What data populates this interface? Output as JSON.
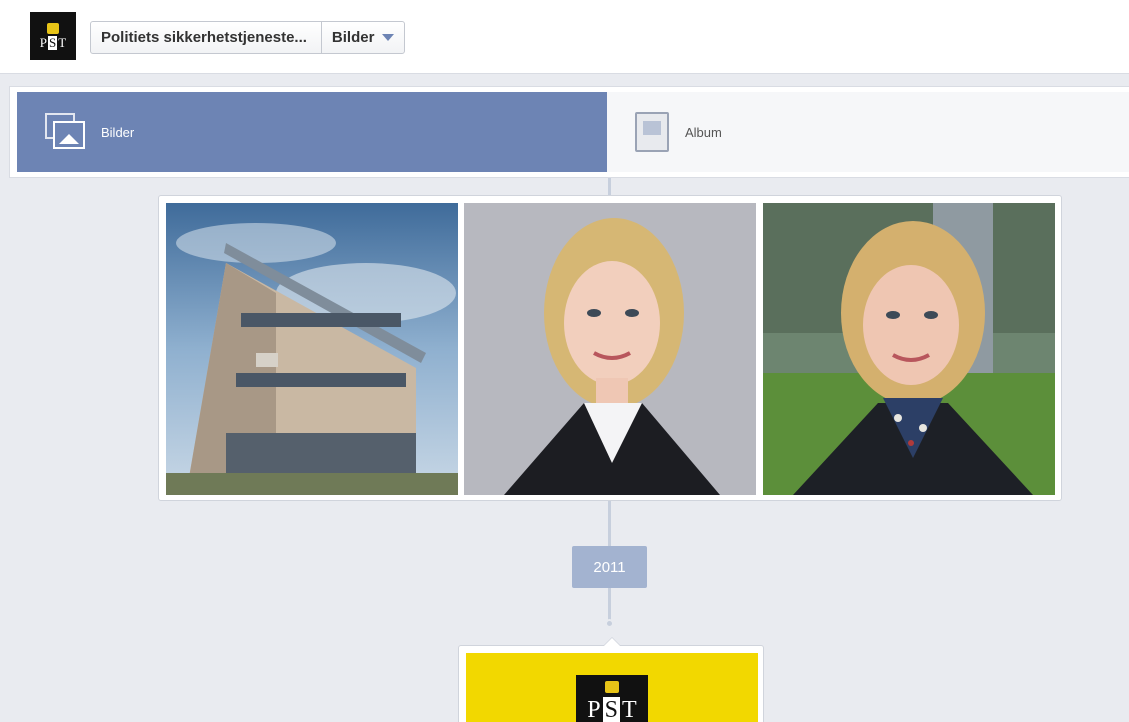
{
  "header": {
    "logo_letters": [
      "P",
      "S",
      "T"
    ],
    "page_name": "Politiets sikkerhetstjeneste...",
    "section": "Bilder"
  },
  "tabs": [
    {
      "label": "Bilder",
      "icon": "photos-icon",
      "active": true
    },
    {
      "label": "Album",
      "icon": "album-icon",
      "active": false
    }
  ],
  "photos": [
    {
      "subject": "building"
    },
    {
      "subject": "portrait-grey-background"
    },
    {
      "subject": "portrait-outdoor"
    }
  ],
  "timeline": {
    "year": "2011"
  },
  "post": {
    "logo_letters": [
      "P",
      "S",
      "T"
    ]
  },
  "colors": {
    "accent": "#6d84b4",
    "background": "#e9ebf0",
    "year_badge": "#a3b3d0",
    "post_yellow": "#f2d800"
  }
}
